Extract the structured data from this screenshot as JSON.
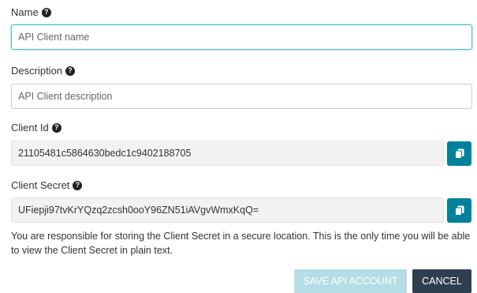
{
  "form": {
    "name": {
      "label": "Name",
      "placeholder": "API Client name",
      "value": ""
    },
    "description": {
      "label": "Description",
      "placeholder": "API Client description",
      "value": ""
    },
    "client_id": {
      "label": "Client Id",
      "value": "21105481c5864630bedc1c9402188705"
    },
    "client_secret": {
      "label": "Client Secret",
      "value": "UFiepji97tvKrYQzq2zcsh0ooY96ZN51iAVgvWmxKqQ="
    },
    "help_glyph": "?",
    "note": "You are responsible for storing the Client Secret in a secure location. This is the only time you will be able to view the Client Secret in plain text."
  },
  "actions": {
    "save_label": "SAVE API ACCOUNT",
    "cancel_label": "CANCEL"
  },
  "icons": {
    "help": "question-circle-icon",
    "copy": "copy-icon"
  },
  "colors": {
    "accent": "#00839a",
    "focus_border": "#4dbfd1",
    "save_disabled": "#b5dde6",
    "cancel": "#2e3f4f",
    "readonly_bg": "#f2f2f2"
  }
}
